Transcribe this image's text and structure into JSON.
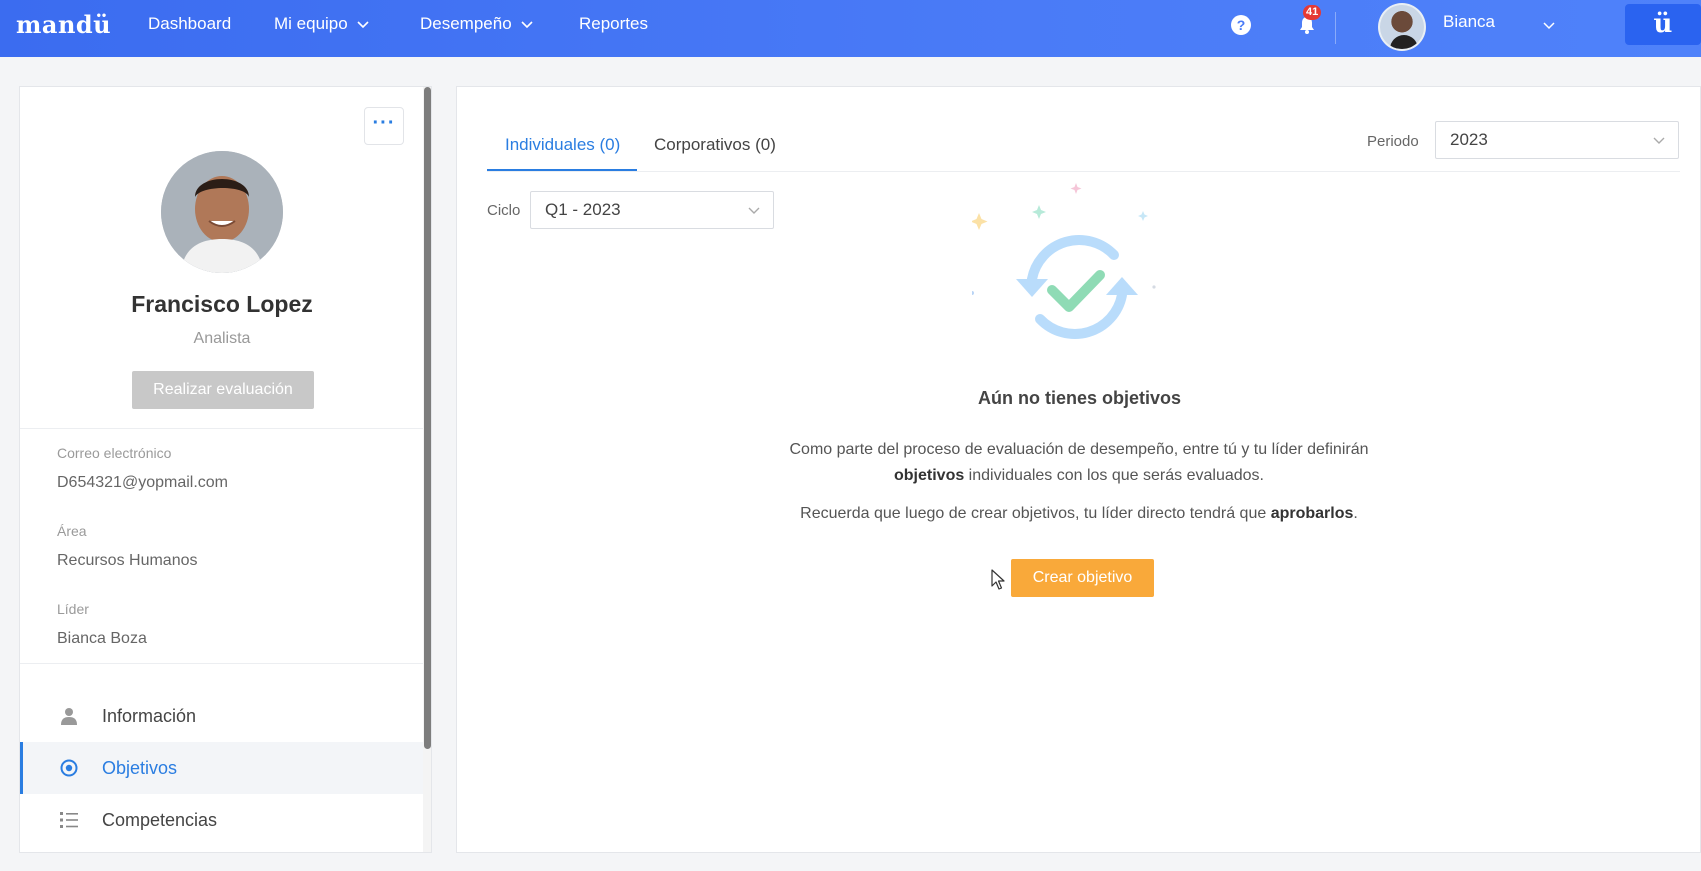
{
  "navbar": {
    "logo": "mandü",
    "items": [
      {
        "label": "Dashboard"
      },
      {
        "label": "Mi equipo"
      },
      {
        "label": "Desempeño"
      },
      {
        "label": "Reportes"
      }
    ],
    "help_label": "?",
    "notifications_count": "41",
    "user_name": "Bianca",
    "app_button_label": "ü",
    "colors": {
      "bar": "#4a7bf7",
      "badge": "#e53935"
    }
  },
  "profile": {
    "more_label": "···",
    "name": "Francisco Lopez",
    "role": "Analista",
    "evaluate_button": "Realizar evaluación",
    "fields": [
      {
        "label": "Correo electrónico",
        "value": "D654321@yopmail.com"
      },
      {
        "label": "Área",
        "value": "Recursos Humanos"
      },
      {
        "label": "Líder",
        "value": "Bianca Boza"
      }
    ],
    "menu": [
      {
        "label": "Información",
        "icon": "user-icon"
      },
      {
        "label": "Objetivos",
        "icon": "target-icon",
        "active": true
      },
      {
        "label": "Competencias",
        "icon": "list-icon"
      }
    ]
  },
  "main": {
    "tabs": [
      {
        "label": "Individuales (0)",
        "active": true
      },
      {
        "label": "Corporativos (0)"
      }
    ],
    "period": {
      "label": "Periodo",
      "value": "2023"
    },
    "cycle": {
      "label": "Ciclo",
      "value": "Q1 - 2023"
    },
    "empty_state": {
      "title": "Aún no tienes objetivos",
      "desc_part1": "Como parte del proceso de evaluación de desempeño, entre tú y tu líder definirán ",
      "desc_bold": "objetivos",
      "desc_part2": " individuales con los que serás evaluados.",
      "note_part1": "Recuerda que luego de crear objetivos, tu líder directo tendrá que ",
      "note_bold": "aprobarlos",
      "note_part2": ".",
      "button": "Crear objetivo"
    },
    "colors": {
      "accent": "#2a7de1",
      "button": "#f9a93a"
    }
  }
}
